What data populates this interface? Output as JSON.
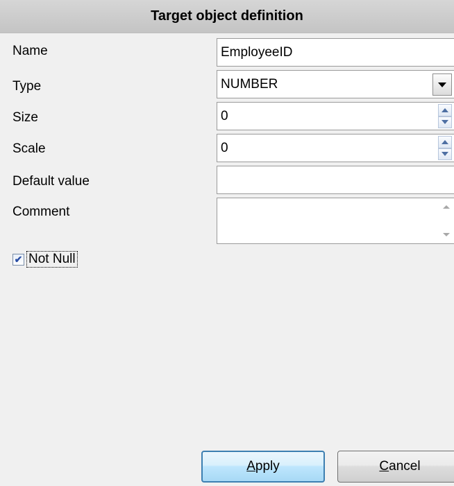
{
  "header": {
    "title": "Target object definition"
  },
  "form": {
    "name": {
      "label": "Name",
      "value": "EmployeeID"
    },
    "type": {
      "label": "Type",
      "value": "NUMBER"
    },
    "size": {
      "label": "Size",
      "value": "0"
    },
    "scale": {
      "label": "Scale",
      "value": "0"
    },
    "default_value": {
      "label": "Default value",
      "value": ""
    },
    "comment": {
      "label": "Comment",
      "value": ""
    }
  },
  "not_null": {
    "label": "Not Null",
    "checked": true
  },
  "buttons": {
    "apply": {
      "label": "Apply",
      "accel": "A",
      "rest": "pply"
    },
    "cancel": {
      "label": "Cancel",
      "accel": "C",
      "rest": "ancel"
    }
  },
  "icons": {
    "dropdown": "chevron-down-icon",
    "spin_up": "spin-up-icon",
    "spin_down": "spin-down-icon",
    "check": "checkmark-icon"
  },
  "colors": {
    "background": "#f0f0f0",
    "header": "#cccccc",
    "apply_border": "#3c7fb1",
    "check": "#2a4ea5"
  }
}
